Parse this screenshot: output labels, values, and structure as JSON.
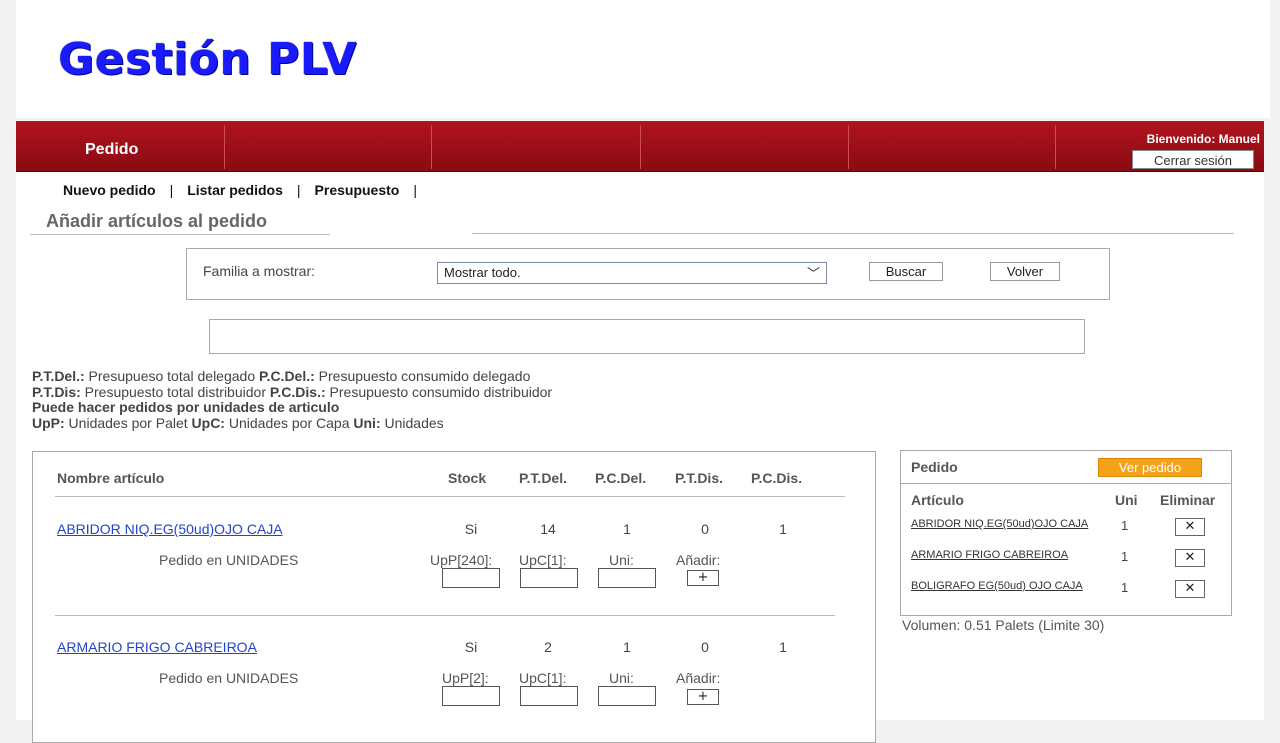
{
  "slide_title": "Gestión PLV",
  "topbar": {
    "menu_label": "Pedido",
    "welcome": "Bienvenido: Manuel",
    "logout_label": "Cerrar sesión"
  },
  "subnav": {
    "items": [
      {
        "label": "Nuevo pedido"
      },
      {
        "label": "Listar pedidos"
      },
      {
        "label": "Presupuesto"
      }
    ],
    "separator": "|"
  },
  "section_title": "Añadir artículos al pedido",
  "filter": {
    "label": "Familia a mostrar:",
    "selected": "Mostrar todo.",
    "search_label": "Buscar",
    "back_label": "Volver"
  },
  "legend": [
    {
      "k1": "P.T.Del.:",
      "v1": " Presupueso total delegado ",
      "k2": "P.C.Del.:",
      "v2": " Presupuesto consumido delegado"
    },
    {
      "k1": "P.T.Dis:",
      "v1": " Presupuesto total distribuidor ",
      "k2": "P.C.Dis.:",
      "v2": " Presupuesto consumido distribuidor"
    },
    {
      "k1": "",
      "v1": "Puede hacer pedidos por unidades de articulo",
      "k2": "",
      "v2": ""
    },
    {
      "k1": "UpP:",
      "v1": " Unidades por Palet ",
      "k2": "UpC:",
      "v2": " Unidades por Capa ",
      "k3": "Uni:",
      "v3": " Unidades"
    }
  ],
  "articles_table": {
    "headers": {
      "name": "Nombre artículo",
      "stock": "Stock",
      "ptdel": "P.T.Del.",
      "pcdel": "P.C.Del.",
      "ptdis": "P.T.Dis.",
      "pcdis": "P.C.Dis."
    },
    "rows": [
      {
        "name": "ABRIDOR NIQ.EG(50ud)OJO CAJA",
        "stock": "Si",
        "ptdel": "14",
        "pcdel": "1",
        "ptdis": "0",
        "pcdis": "1",
        "mode": "Pedido en UNIDADES",
        "upp_label": "UpP[240]:",
        "upc_label": "UpC[1]:",
        "uni_label": "Uni:",
        "add_label": "Añadir:",
        "add_btn": "+"
      },
      {
        "name": "ARMARIO FRIGO CABREIROA",
        "stock": "Si",
        "ptdel": "2",
        "pcdel": "1",
        "ptdis": "0",
        "pcdis": "1",
        "mode": "Pedido en UNIDADES",
        "upp_label": "UpP[2]:",
        "upc_label": "UpC[1]:",
        "uni_label": "Uni:",
        "add_label": "Añadir:",
        "add_btn": "+"
      }
    ]
  },
  "cart": {
    "title": "Pedido",
    "view_label": "Ver pedido",
    "col_article": "Artículo",
    "col_uni": "Uni",
    "col_delete": "Eliminar",
    "delete_symbol": "✕",
    "items": [
      {
        "name": "ABRIDOR NIQ.EG(50ud)OJO CAJA",
        "uni": "1"
      },
      {
        "name": "ARMARIO FRIGO CABREIROA",
        "uni": "1"
      },
      {
        "name": "BOLIGRAFO EG(50ud) OJO CAJA",
        "uni": "1"
      }
    ],
    "volume": "Volumen: 0.51 Palets (Limite 30)"
  },
  "colors": {
    "menu_red": "#a00f19",
    "title_blue": "#1a1aff",
    "link_blue": "#2244cc",
    "view_orange": "#f5a21b"
  }
}
